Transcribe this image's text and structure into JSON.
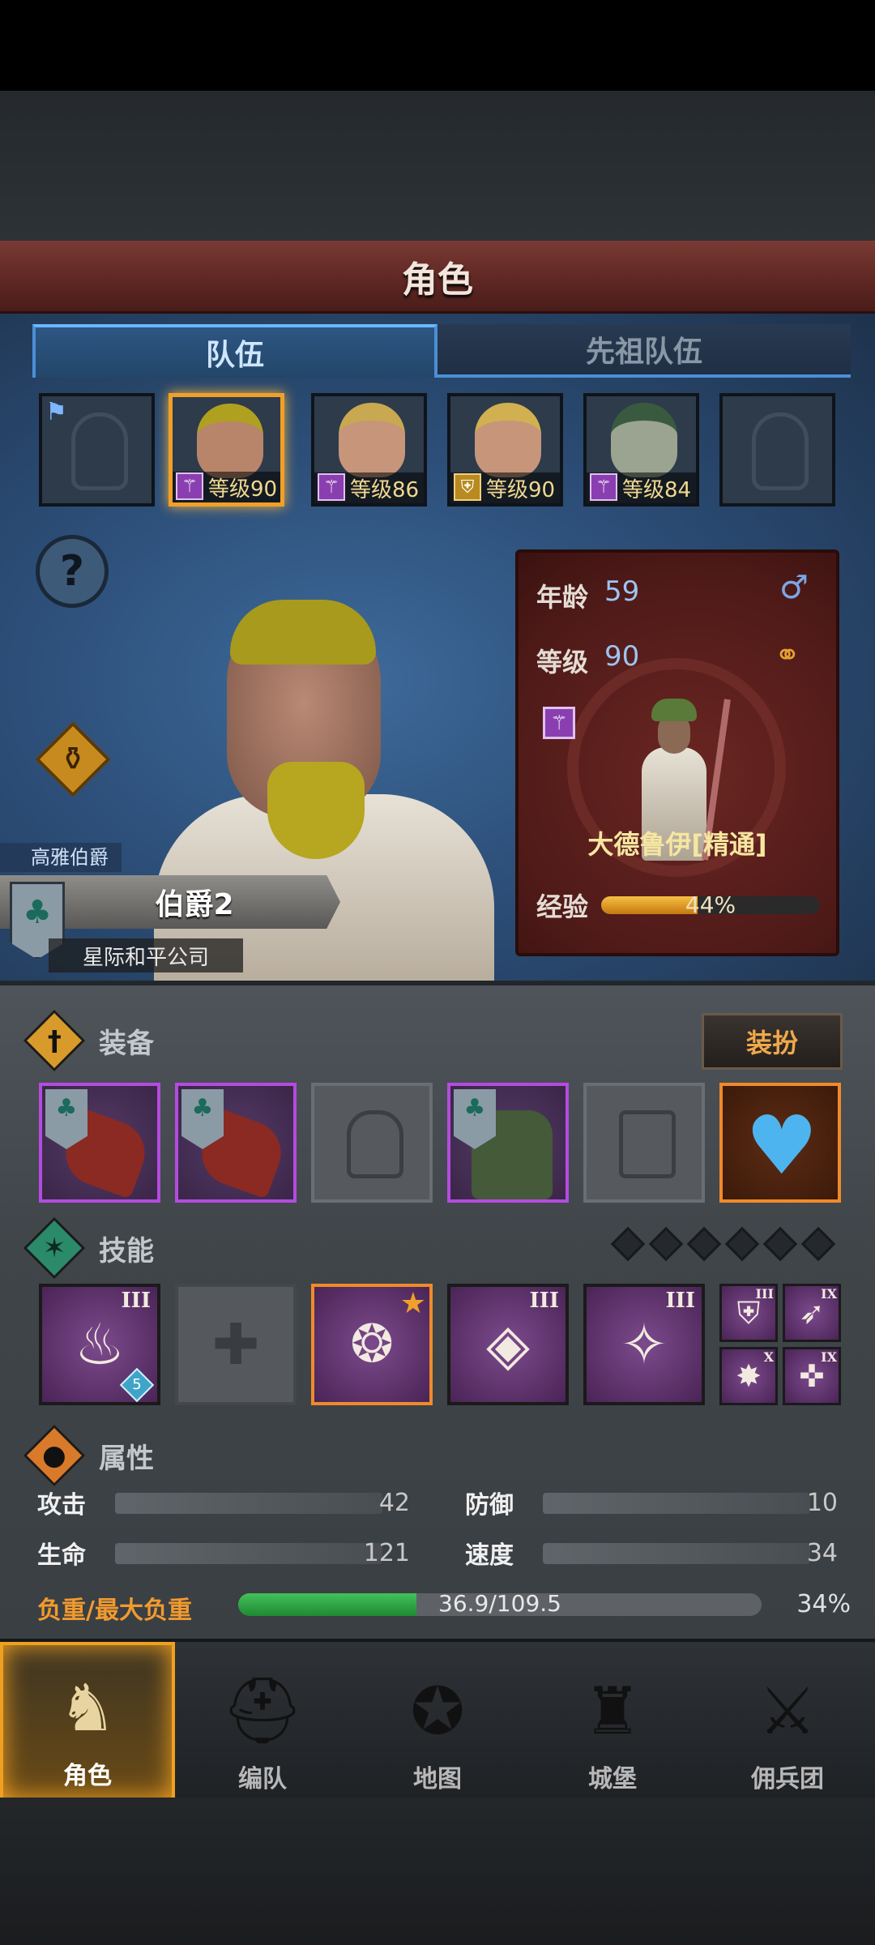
{
  "title": "角色",
  "tabs": {
    "team": "队伍",
    "ancestor": "先祖队伍"
  },
  "roster": [
    {
      "type": "empty"
    },
    {
      "type": "hero",
      "level_text": "等级90",
      "class_icon": "staff-icon",
      "face_color": "#b8856a",
      "hair_color": "#b0a020"
    },
    {
      "type": "hero",
      "level_text": "等级86",
      "class_icon": "staff-icon",
      "face_color": "#c6957a",
      "hair_color": "#c8a850"
    },
    {
      "type": "hero",
      "level_text": "等级90",
      "class_icon": "shield-icon",
      "face_color": "#c6957a",
      "hair_color": "#d0b050"
    },
    {
      "type": "hero",
      "level_text": "等级84",
      "class_icon": "staff-icon",
      "face_color": "#9aa490",
      "hair_color": "#3a5a40"
    },
    {
      "type": "empty"
    }
  ],
  "stats_card": {
    "age_label": "年龄",
    "age": "59",
    "level_label": "等级",
    "level": "90",
    "class_name": "大德鲁伊[精通]",
    "exp_label": "经验",
    "exp_pct_text": "44%",
    "exp_pct": 0.44
  },
  "identity": {
    "rank_title": "高雅伯爵",
    "name": "伯爵2",
    "company": "星际和平公司"
  },
  "equipment": {
    "label": "装备",
    "dress_button": "装扮"
  },
  "skills": {
    "label": "技能",
    "slots": [
      {
        "icon": "fire-icon",
        "glyph": "♨",
        "rank": "III",
        "gem": "5"
      },
      {
        "icon": "empty-cross-icon",
        "glyph": "✚"
      },
      {
        "icon": "tornado-icon",
        "glyph": "🌀",
        "star": true
      },
      {
        "icon": "crystal-hand-icon",
        "glyph": "◈",
        "rank": "III"
      },
      {
        "icon": "holy-spear-icon",
        "glyph": "✧",
        "rank": "III"
      }
    ],
    "minis": [
      {
        "icon": "shield-icon",
        "glyph": "⛨",
        "rank": "III"
      },
      {
        "icon": "spear-icon",
        "glyph": "➶",
        "rank": "IX"
      },
      {
        "icon": "burst-icon",
        "glyph": "✸",
        "rank": "X"
      },
      {
        "icon": "holy-star-icon",
        "glyph": "✜",
        "rank": "IX"
      }
    ]
  },
  "attributes": {
    "label": "属性",
    "attack_label": "攻击",
    "attack": "42",
    "defense_label": "防御",
    "defense": "10",
    "hp_label": "生命",
    "hp": "121",
    "speed_label": "速度",
    "speed": "34",
    "load_label": "负重/最大负重",
    "load_text": "36.9/109.5",
    "load_pct_text": "34%",
    "load_pct": 0.34
  },
  "nav": [
    {
      "label": "角色",
      "icon": "knight-icon",
      "glyph": "♞",
      "active": true
    },
    {
      "label": "编队",
      "icon": "helmet-icon",
      "glyph": "⛑",
      "active": false
    },
    {
      "label": "地图",
      "icon": "compass-icon",
      "glyph": "✪",
      "active": false
    },
    {
      "label": "城堡",
      "icon": "castle-icon",
      "glyph": "♜",
      "active": false
    },
    {
      "label": "佣兵团",
      "icon": "mercenary-icon",
      "glyph": "⚔",
      "active": false
    }
  ]
}
